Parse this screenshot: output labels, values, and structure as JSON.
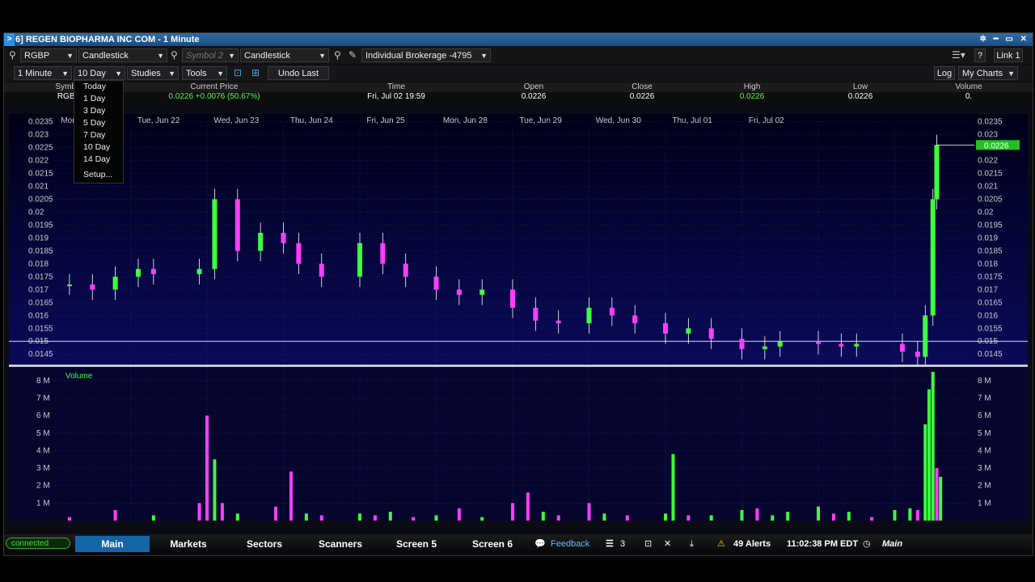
{
  "window": {
    "number": ">",
    "title": "6] REGEN BIOPHARMA INC COM - 1 Minute",
    "controls": "✲ ━ ▭ ✕"
  },
  "toolbar1": {
    "symbol1": "RGBP",
    "chart_type1": "Candlestick",
    "symbol2_placeholder": "Symbol 2",
    "chart_type2": "Candlestick",
    "account": "Individual Brokerage -4795",
    "link": "Link 1",
    "help": "?"
  },
  "toolbar2": {
    "interval": "1 Minute",
    "period": "10 Day",
    "studies": "Studies",
    "tools": "Tools",
    "undo": "Undo Last",
    "log": "Log",
    "my_charts": "My Charts"
  },
  "period_menu": [
    "Today",
    "1 Day",
    "3 Day",
    "5 Day",
    "7 Day",
    "10 Day",
    "14 Day"
  ],
  "period_menu_setup": "Setup...",
  "quote": {
    "headers": {
      "symbol": "Symbol",
      "current": "Current Price",
      "time": "Time",
      "open": "Open",
      "close": "Close",
      "high": "High",
      "low": "Low",
      "volume": "Volume"
    },
    "values": {
      "symbol": "RGBP",
      "current": "0.0226  +0.0076 (50.67%)",
      "time": "Fri, Jul 02  19:59",
      "open": "0.0226",
      "close": "0.0226",
      "high": "0.0226",
      "low": "0.0226",
      "volume": "0."
    }
  },
  "chart_data": [
    {
      "type": "candlestick",
      "x_dates": [
        "Mon, Jun 21",
        "Tue, Jun 22",
        "Wed, Jun 23",
        "Thu, Jun 24",
        "Fri, Jun 25",
        "Mon, Jun 28",
        "Tue, Jun 29",
        "Wed, Jun 30",
        "Thu, Jul 01",
        "Fri, Jul 02"
      ],
      "y_ticks": [
        "0.0235",
        "0.023",
        "0.0225",
        "0.022",
        "0.0215",
        "0.021",
        "0.0205",
        "0.02",
        "0.0195",
        "0.019",
        "0.0185",
        "0.018",
        "0.0175",
        "0.017",
        "0.0165",
        "0.016",
        "0.0155",
        "0.015",
        "0.0145"
      ],
      "ylim": [
        0.0141,
        0.0238
      ],
      "last_price_label": "0.0226",
      "last_price": 0.0226,
      "reference_line": 0.015,
      "colors": {
        "up": "#3cff3c",
        "down": "#ff3cff",
        "background": "#0a0a5a"
      },
      "series": [
        {
          "x": 0.02,
          "y": 0.0172
        },
        {
          "x": 0.05,
          "y": 0.017
        },
        {
          "x": 0.08,
          "y": 0.0175
        },
        {
          "x": 0.11,
          "y": 0.0178
        },
        {
          "x": 0.13,
          "y": 0.0176
        },
        {
          "x": 0.19,
          "y": 0.0178
        },
        {
          "x": 0.21,
          "y": 0.0205
        },
        {
          "x": 0.24,
          "y": 0.0185
        },
        {
          "x": 0.27,
          "y": 0.0192
        },
        {
          "x": 0.3,
          "y": 0.0188
        },
        {
          "x": 0.32,
          "y": 0.018
        },
        {
          "x": 0.35,
          "y": 0.0175
        },
        {
          "x": 0.4,
          "y": 0.0188
        },
        {
          "x": 0.43,
          "y": 0.018
        },
        {
          "x": 0.46,
          "y": 0.0175
        },
        {
          "x": 0.5,
          "y": 0.017
        },
        {
          "x": 0.53,
          "y": 0.0168
        },
        {
          "x": 0.56,
          "y": 0.017
        },
        {
          "x": 0.6,
          "y": 0.0163
        },
        {
          "x": 0.63,
          "y": 0.0158
        },
        {
          "x": 0.66,
          "y": 0.0157
        },
        {
          "x": 0.7,
          "y": 0.0163
        },
        {
          "x": 0.73,
          "y": 0.016
        },
        {
          "x": 0.76,
          "y": 0.0157
        },
        {
          "x": 0.8,
          "y": 0.0153
        },
        {
          "x": 0.83,
          "y": 0.0155
        },
        {
          "x": 0.86,
          "y": 0.0151
        },
        {
          "x": 0.9,
          "y": 0.0147
        },
        {
          "x": 0.93,
          "y": 0.0148
        },
        {
          "x": 0.95,
          "y": 0.015
        },
        {
          "x": 1.0,
          "y": 0.0149
        },
        {
          "x": 1.03,
          "y": 0.0148
        },
        {
          "x": 1.05,
          "y": 0.0149
        },
        {
          "x": 1.11,
          "y": 0.0146
        },
        {
          "x": 1.13,
          "y": 0.0144
        },
        {
          "x": 1.14,
          "y": 0.016
        },
        {
          "x": 1.15,
          "y": 0.0205
        },
        {
          "x": 1.155,
          "y": 0.0226
        }
      ]
    },
    {
      "type": "bar",
      "title": "Volume",
      "y_ticks": [
        "8 M",
        "7 M",
        "6 M",
        "5 M",
        "4 M",
        "3 M",
        "2 M",
        "1 M"
      ],
      "ylim": [
        0,
        8.5
      ],
      "bars": [
        {
          "x": 0.02,
          "v": 0.2,
          "c": "d"
        },
        {
          "x": 0.08,
          "v": 0.6,
          "c": "d"
        },
        {
          "x": 0.13,
          "v": 0.3,
          "c": "u"
        },
        {
          "x": 0.19,
          "v": 1.0,
          "c": "d"
        },
        {
          "x": 0.2,
          "v": 6.0,
          "c": "d"
        },
        {
          "x": 0.21,
          "v": 3.5,
          "c": "u"
        },
        {
          "x": 0.22,
          "v": 1.0,
          "c": "d"
        },
        {
          "x": 0.24,
          "v": 0.4,
          "c": "u"
        },
        {
          "x": 0.29,
          "v": 0.8,
          "c": "d"
        },
        {
          "x": 0.31,
          "v": 2.8,
          "c": "d"
        },
        {
          "x": 0.33,
          "v": 0.4,
          "c": "u"
        },
        {
          "x": 0.35,
          "v": 0.3,
          "c": "d"
        },
        {
          "x": 0.4,
          "v": 0.4,
          "c": "u"
        },
        {
          "x": 0.42,
          "v": 0.3,
          "c": "d"
        },
        {
          "x": 0.44,
          "v": 0.5,
          "c": "u"
        },
        {
          "x": 0.47,
          "v": 0.2,
          "c": "d"
        },
        {
          "x": 0.5,
          "v": 0.3,
          "c": "u"
        },
        {
          "x": 0.53,
          "v": 0.7,
          "c": "d"
        },
        {
          "x": 0.56,
          "v": 0.2,
          "c": "u"
        },
        {
          "x": 0.6,
          "v": 1.0,
          "c": "d"
        },
        {
          "x": 0.62,
          "v": 1.6,
          "c": "d"
        },
        {
          "x": 0.64,
          "v": 0.5,
          "c": "u"
        },
        {
          "x": 0.66,
          "v": 0.3,
          "c": "d"
        },
        {
          "x": 0.7,
          "v": 1.0,
          "c": "d"
        },
        {
          "x": 0.72,
          "v": 0.4,
          "c": "u"
        },
        {
          "x": 0.75,
          "v": 0.3,
          "c": "d"
        },
        {
          "x": 0.8,
          "v": 0.4,
          "c": "u"
        },
        {
          "x": 0.81,
          "v": 3.8,
          "c": "u"
        },
        {
          "x": 0.83,
          "v": 0.3,
          "c": "d"
        },
        {
          "x": 0.86,
          "v": 0.3,
          "c": "u"
        },
        {
          "x": 0.9,
          "v": 0.6,
          "c": "u"
        },
        {
          "x": 0.92,
          "v": 0.7,
          "c": "d"
        },
        {
          "x": 0.94,
          "v": 0.3,
          "c": "u"
        },
        {
          "x": 0.96,
          "v": 0.5,
          "c": "u"
        },
        {
          "x": 1.0,
          "v": 0.8,
          "c": "u"
        },
        {
          "x": 1.02,
          "v": 0.4,
          "c": "d"
        },
        {
          "x": 1.04,
          "v": 0.5,
          "c": "u"
        },
        {
          "x": 1.07,
          "v": 0.2,
          "c": "d"
        },
        {
          "x": 1.1,
          "v": 0.6,
          "c": "u"
        },
        {
          "x": 1.12,
          "v": 0.7,
          "c": "u"
        },
        {
          "x": 1.13,
          "v": 0.6,
          "c": "d"
        },
        {
          "x": 1.14,
          "v": 5.5,
          "c": "u"
        },
        {
          "x": 1.145,
          "v": 7.5,
          "c": "u"
        },
        {
          "x": 1.15,
          "v": 8.5,
          "c": "u"
        },
        {
          "x": 1.155,
          "v": 3.0,
          "c": "d"
        },
        {
          "x": 1.16,
          "v": 2.5,
          "c": "u"
        }
      ]
    }
  ],
  "taskbar": {
    "connected": "connected",
    "tabs": [
      "Main",
      "Markets",
      "Sectors",
      "Scanners",
      "Screen 5",
      "Screen 6"
    ],
    "feedback": "Feedback",
    "count": "3",
    "alerts": "49 Alerts",
    "clock": "11:02:38 PM EDT",
    "workspace": "Main"
  }
}
